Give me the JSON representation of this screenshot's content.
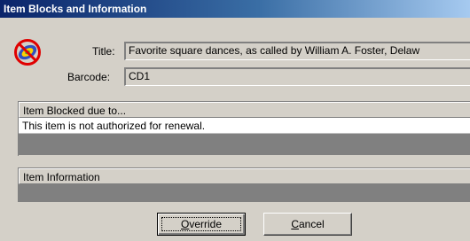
{
  "window": {
    "title": "Item Blocks and Information"
  },
  "icon": {
    "name": "blocked-item-icon"
  },
  "fields": {
    "title_label": "Title:",
    "title_value": "Favorite square dances, as called by William A. Foster, Delaw",
    "barcode_label": "Barcode:",
    "barcode_value": "CD1"
  },
  "blocked_panel": {
    "header": "Item Blocked due to...",
    "reasons": [
      "This item is not authorized for renewal."
    ]
  },
  "info_panel": {
    "header": "Item Information"
  },
  "buttons": {
    "override": {
      "mnemonic": "O",
      "rest": "verride"
    },
    "cancel": {
      "mnemonic": "C",
      "rest": "ancel"
    }
  },
  "colors": {
    "titlebar_start": "#0a246a",
    "titlebar_end": "#a6caf0",
    "dialog_bg": "#d4d0c8"
  }
}
